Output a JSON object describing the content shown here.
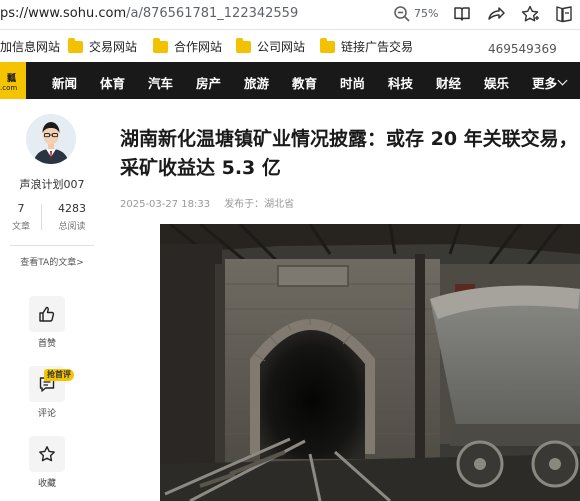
{
  "browser": {
    "url_host": "ps://www.sohu.com",
    "url_path": "/a/876561781_122342559",
    "zoom": "75%",
    "icons": [
      "zoom-out-icon",
      "reader-icon",
      "share-icon",
      "star-icon",
      "collections-icon"
    ]
  },
  "bookmarks": {
    "items": [
      {
        "label": "加信息网站",
        "folder": false
      },
      {
        "label": "交易网站",
        "folder": true
      },
      {
        "label": "合作网站",
        "folder": true
      },
      {
        "label": "公司网站",
        "folder": true
      },
      {
        "label": "链接广告交易",
        "folder": true
      }
    ],
    "number": "469549369"
  },
  "nav": {
    "logo_text": "瓢",
    "logo_domain": ".com",
    "items": [
      "新闻",
      "体育",
      "汽车",
      "房产",
      "旅游",
      "教育",
      "时尚",
      "科技",
      "财经",
      "娱乐",
      "更多"
    ]
  },
  "author": {
    "name": "声浪计划007",
    "articles_count": "7",
    "articles_label": "文章",
    "reads_count": "4283",
    "reads_label": "总阅读",
    "view_link": "查看TA的文章>"
  },
  "actions": {
    "like_label": "首赞",
    "comment_badge": "抢首评",
    "comment_label": "评论",
    "collect_label": "收藏"
  },
  "article": {
    "title": "湖南新化温塘镇矿业情况披露：或存 20 年关联交易，采矿收益达 5.3 亿",
    "date": "2025-03-27 18:33",
    "location": "发布于：湖北省"
  },
  "colors": {
    "nav_bg": "#191919",
    "brand_yellow": "#f5c400"
  }
}
